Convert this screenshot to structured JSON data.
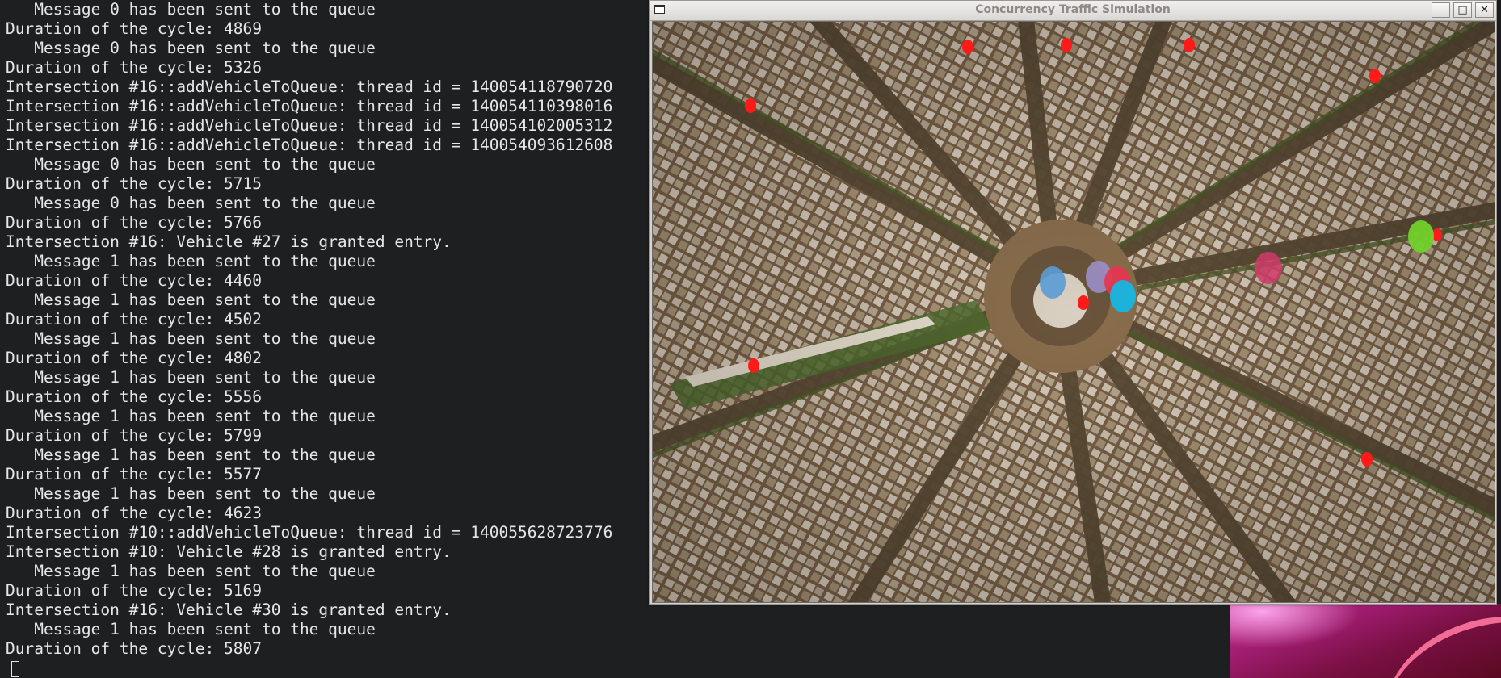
{
  "terminal": {
    "lines": [
      "   Message 0 has been sent to the queue",
      "Duration of the cycle: 4869",
      "   Message 0 has been sent to the queue",
      "Duration of the cycle: 5326",
      "Intersection #16::addVehicleToQueue: thread id = 140054118790720",
      "Intersection #16::addVehicleToQueue: thread id = 140054110398016",
      "Intersection #16::addVehicleToQueue: thread id = 140054102005312",
      "Intersection #16::addVehicleToQueue: thread id = 140054093612608",
      "   Message 0 has been sent to the queue",
      "Duration of the cycle: 5715",
      "   Message 0 has been sent to the queue",
      "Duration of the cycle: 5766",
      "Intersection #16: Vehicle #27 is granted entry.",
      "   Message 1 has been sent to the queue",
      "Duration of the cycle: 4460",
      "   Message 1 has been sent to the queue",
      "Duration of the cycle: 4502",
      "   Message 1 has been sent to the queue",
      "Duration of the cycle: 4802",
      "   Message 1 has been sent to the queue",
      "Duration of the cycle: 5556",
      "   Message 1 has been sent to the queue",
      "Duration of the cycle: 5799",
      "   Message 1 has been sent to the queue",
      "Duration of the cycle: 5577",
      "   Message 1 has been sent to the queue",
      "Duration of the cycle: 4623",
      "Intersection #10::addVehicleToQueue: thread id = 140055628723776",
      "Intersection #10: Vehicle #28 is granted entry.",
      "   Message 1 has been sent to the queue",
      "Duration of the cycle: 5169",
      "Intersection #16: Vehicle #30 is granted entry.",
      "   Message 1 has been sent to the queue",
      "Duration of the cycle: 5807"
    ]
  },
  "window": {
    "title": "Concurrency Traffic Simulation",
    "minimize_glyph": "_",
    "maximize_glyph": "□",
    "close_glyph": "✕"
  },
  "simulation": {
    "traffic_light_color": "#ff1a1a",
    "vehicles": [
      {
        "color": "#5b9bd5"
      },
      {
        "color": "#9b8fc9"
      },
      {
        "color": "#e8344f"
      },
      {
        "color": "#16b6e0"
      },
      {
        "color": "#d03a6a"
      },
      {
        "color": "#72d12a"
      }
    ]
  }
}
